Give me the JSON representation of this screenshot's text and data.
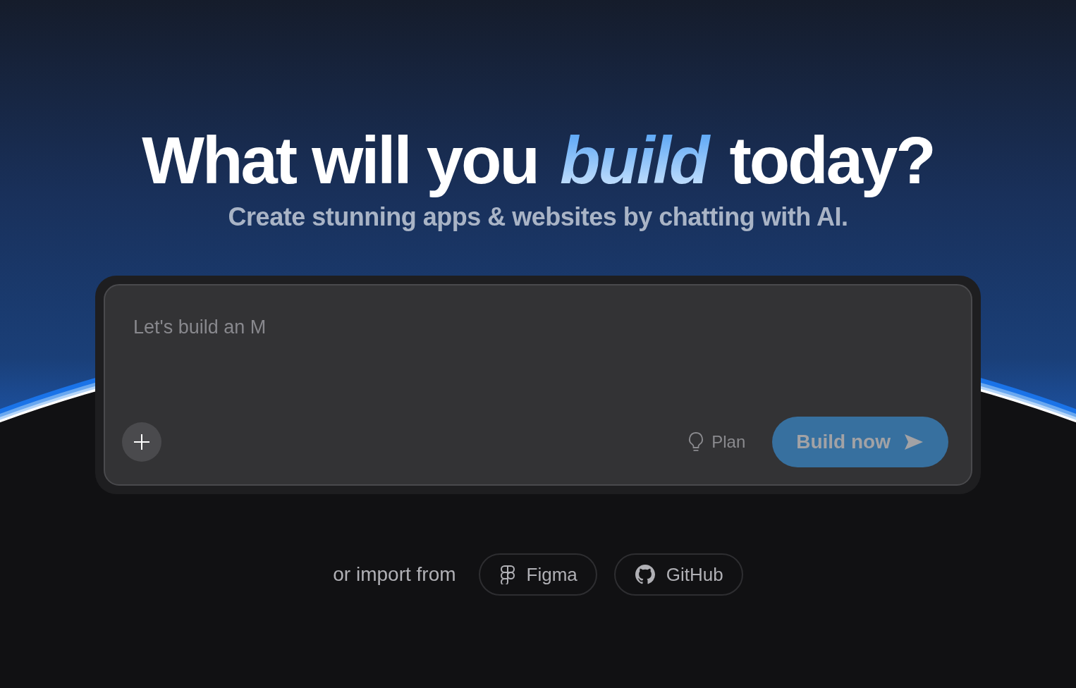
{
  "hero": {
    "title": "What will you *build* today?",
    "subtitle": "Create stunning apps & websites by chatting with AI."
  },
  "prompt": {
    "placeholder": "Let's build an M",
    "plan_label": "Plan",
    "submit": {
      "label": "Build now",
      "disabled": true
    }
  },
  "import": {
    "label": "or import from",
    "sources": [
      {
        "kind": "figma",
        "label": "Figma"
      },
      {
        "kind": "github",
        "label": "GitHub"
      }
    ]
  }
}
